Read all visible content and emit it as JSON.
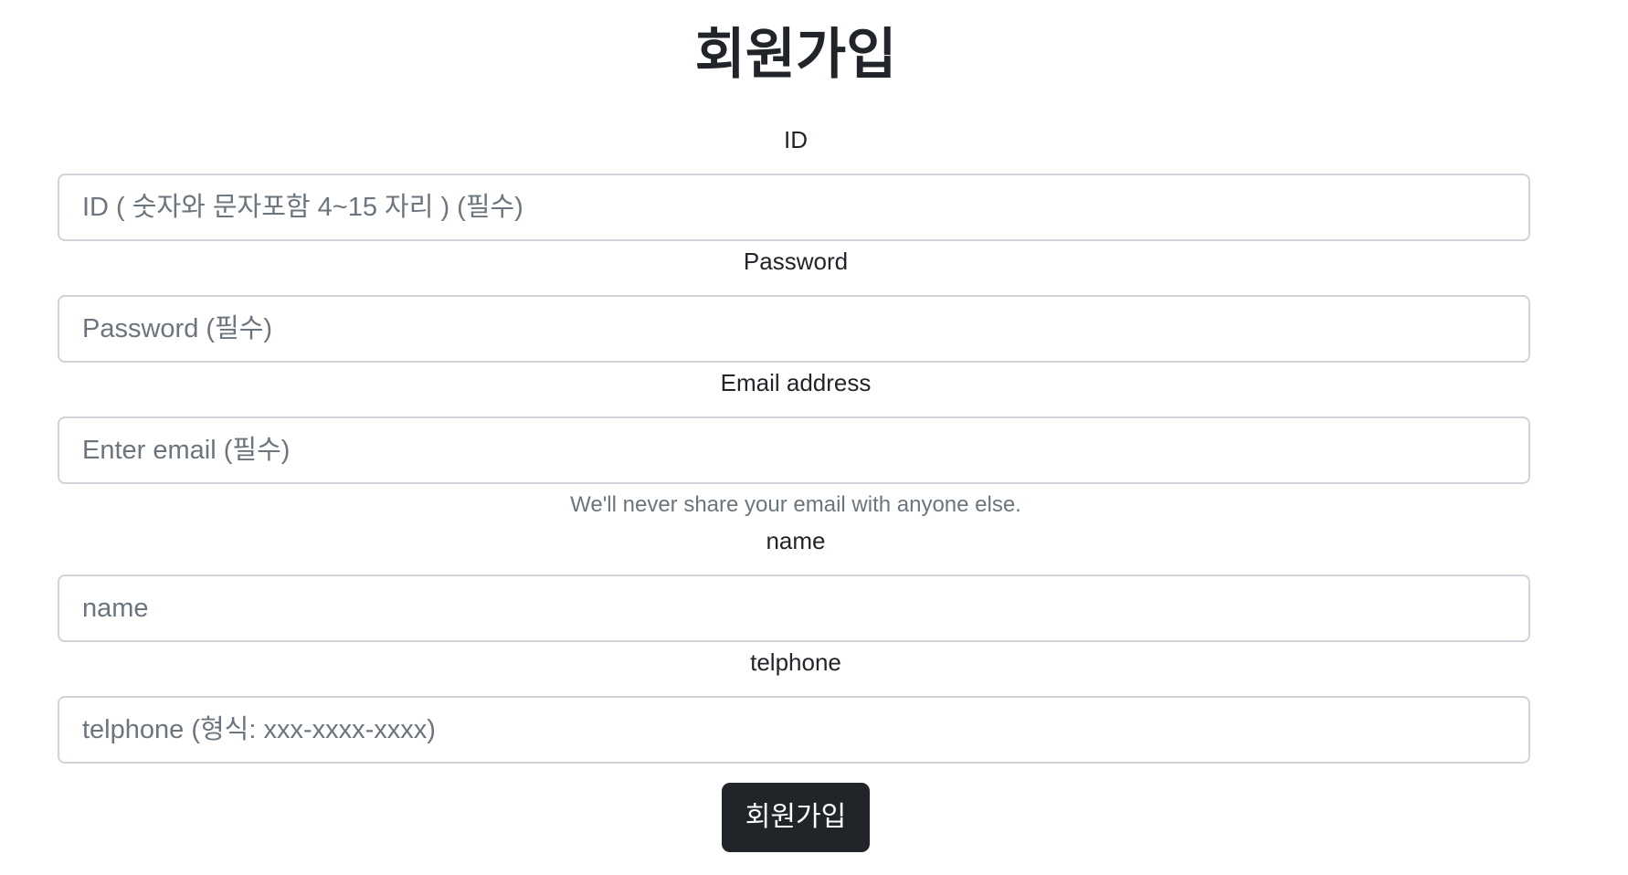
{
  "form": {
    "title": "회원가입",
    "fields": {
      "id": {
        "label": "ID",
        "placeholder": "ID ( 숫자와 문자포함 4~15 자리 ) (필수)",
        "value": ""
      },
      "password": {
        "label": "Password",
        "placeholder": "Password (필수)",
        "value": ""
      },
      "email": {
        "label": "Email address",
        "placeholder": "Enter email (필수)",
        "value": "",
        "help": "We'll never share your email with anyone else."
      },
      "name": {
        "label": "name",
        "placeholder": "name",
        "value": ""
      },
      "telphone": {
        "label": "telphone",
        "placeholder": "telphone (형식: xxx-xxxx-xxxx)",
        "value": ""
      }
    },
    "submit_label": "회원가입"
  },
  "colors": {
    "text": "#212529",
    "muted": "#6c757d",
    "border": "#ced4da",
    "button_bg": "#212529",
    "button_text": "#ffffff",
    "background": "#ffffff"
  }
}
